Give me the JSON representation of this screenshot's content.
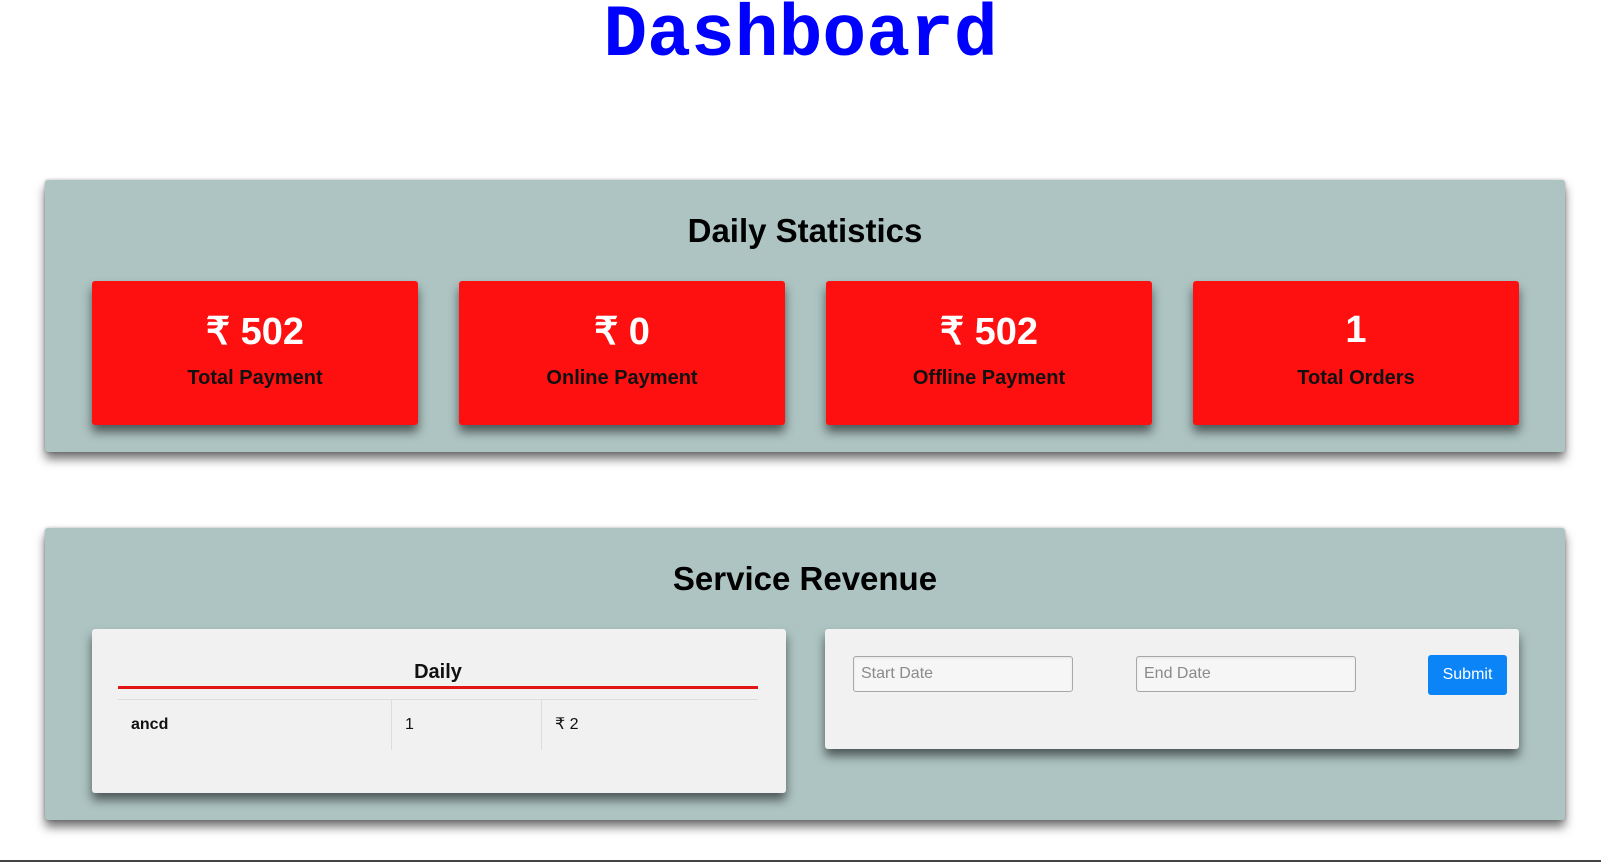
{
  "page": {
    "title": "Dashboard"
  },
  "daily_statistics": {
    "title": "Daily Statistics",
    "cards": [
      {
        "value": "₹ 502",
        "label": "Total Payment"
      },
      {
        "value": "₹ 0",
        "label": "Online Payment"
      },
      {
        "value": "₹ 502",
        "label": "Offline Payment"
      },
      {
        "value": "1",
        "label": "Total Orders"
      }
    ]
  },
  "service_revenue": {
    "title": "Service Revenue",
    "daily": {
      "header": "Daily",
      "rows": [
        {
          "service": "ancd",
          "count": "1",
          "amount": "₹ 2"
        }
      ]
    },
    "range": {
      "start_placeholder": "Start Date",
      "end_placeholder": "End Date",
      "submit_label": "Submit"
    }
  },
  "colors": {
    "title": "#0000ff",
    "section_bg": "#adc4c2",
    "card_bg": "#fe1010",
    "panel_bg": "#f1f1f1",
    "accent_rule": "#e31414",
    "button": "#0a84f7"
  }
}
